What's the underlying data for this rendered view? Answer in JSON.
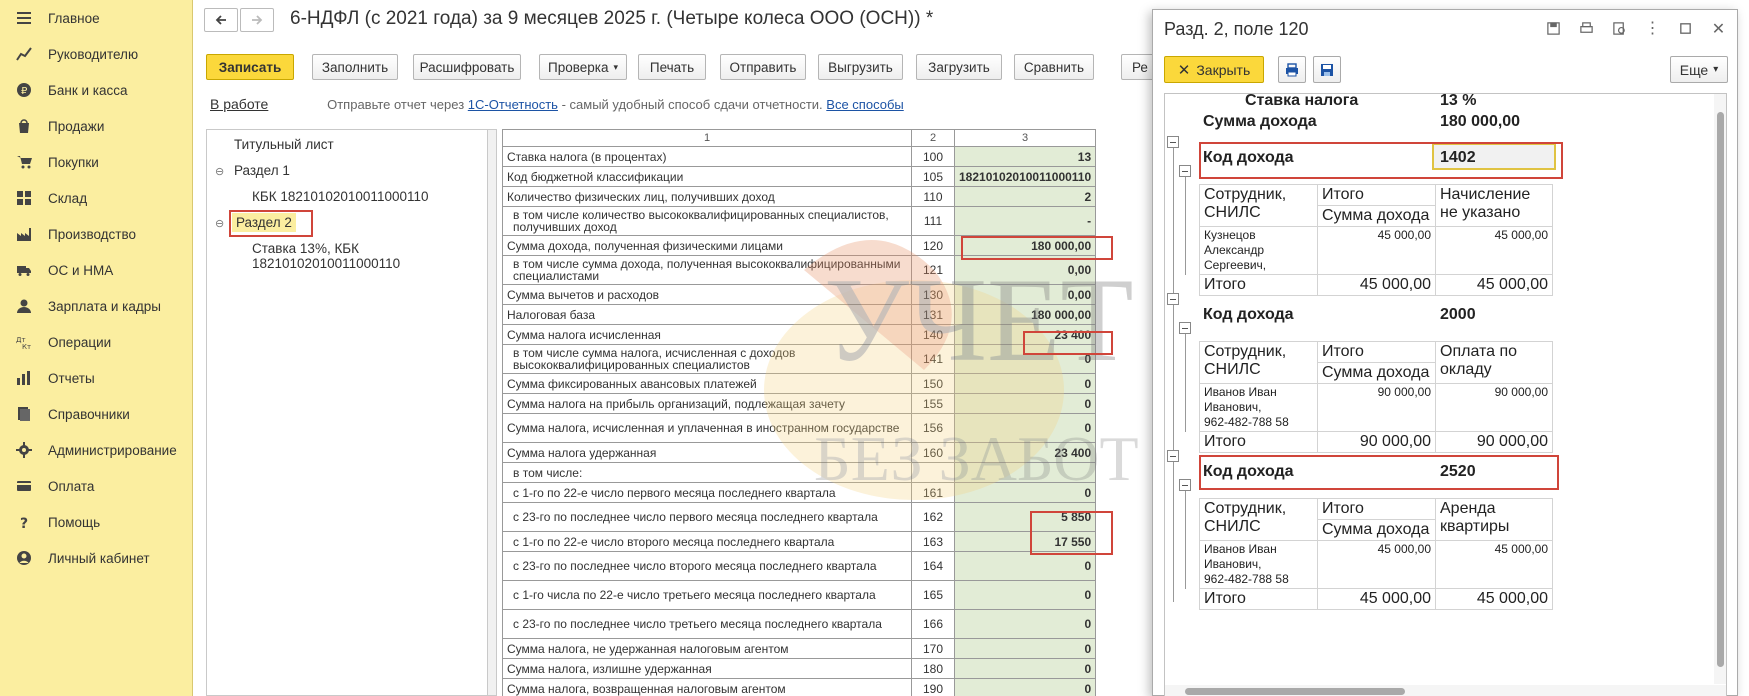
{
  "sidebar": {
    "items": [
      {
        "label": "Главное",
        "icon": "menu-icon"
      },
      {
        "label": "Руководителю",
        "icon": "chart-icon"
      },
      {
        "label": "Банк и касса",
        "icon": "ruble-icon"
      },
      {
        "label": "Продажи",
        "icon": "bag-icon"
      },
      {
        "label": "Покупки",
        "icon": "cart-icon"
      },
      {
        "label": "Склад",
        "icon": "grid-icon"
      },
      {
        "label": "Производство",
        "icon": "factory-icon"
      },
      {
        "label": "ОС и НМА",
        "icon": "truck-icon"
      },
      {
        "label": "Зарплата и кадры",
        "icon": "person-icon"
      },
      {
        "label": "Операции",
        "icon": "dtkt-icon"
      },
      {
        "label": "Отчеты",
        "icon": "bar-chart-icon"
      },
      {
        "label": "Справочники",
        "icon": "book-icon"
      },
      {
        "label": "Администрирование",
        "icon": "gear-icon"
      },
      {
        "label": "Оплата",
        "icon": "card-icon"
      },
      {
        "label": "Помощь",
        "icon": "question-icon"
      },
      {
        "label": "Личный кабинет",
        "icon": "account-icon"
      }
    ]
  },
  "header": {
    "title": "6-НДФЛ (с 2021 года) за 9 месяцев 2025 г. (Четыре колеса ООО (ОСН)) *"
  },
  "toolbar": {
    "save": "Записать",
    "fill": "Заполнить",
    "decode": "Расшифровать",
    "check": "Проверка",
    "print": "Печать",
    "send": "Отправить",
    "upload": "Выгрузить",
    "download": "Загрузить",
    "compare": "Сравнить",
    "cut": "Ре"
  },
  "status": {
    "state": "В работе",
    "info_pre": "Отправьте отчет через ",
    "info_link": "1С-Отчетность",
    "info_post": " - самый удобный способ сдачи отчетности. ",
    "all_ways": "Все способы"
  },
  "tree": {
    "title": "Титульный лист",
    "section1": "Раздел 1",
    "kbk1": "КБК 18210102010011000110",
    "section2": "Раздел 2",
    "rate_line1": "Ставка 13%, КБК",
    "rate_line2": "18210102010011000110"
  },
  "table": {
    "head": [
      "1",
      "2",
      "3"
    ],
    "rows": [
      {
        "name": "Ставка налога (в процентах)",
        "code": "100",
        "value": "13"
      },
      {
        "name": "Код бюджетной классификации",
        "code": "105",
        "value": "18210102010011000110"
      },
      {
        "name": "Количество физических лиц, получивших доход",
        "code": "110",
        "value": "2"
      },
      {
        "name": "в том числе количество высококвалифицированных специалистов, получивших доход",
        "code": "111",
        "value": "-"
      },
      {
        "name": "Сумма дохода, полученная физическими лицами",
        "code": "120",
        "value": "180 000,00"
      },
      {
        "name": "в том числе сумма дохода, полученная высококвалифицированными специалистами",
        "code": "121",
        "value": "0,00"
      },
      {
        "name": "Сумма вычетов и расходов",
        "code": "130",
        "value": "0,00"
      },
      {
        "name": "Налоговая база",
        "code": "131",
        "value": "180 000,00"
      },
      {
        "name": "Сумма налога исчисленная",
        "code": "140",
        "value": "23 400"
      },
      {
        "name": "в том числе сумма налога, исчисленная с доходов высококвалифицированных специалистов",
        "code": "141",
        "value": "0"
      },
      {
        "name": "Сумма фиксированных авансовых платежей",
        "code": "150",
        "value": "0"
      },
      {
        "name": "Сумма налога на прибыль организаций, подлежащая зачету",
        "code": "155",
        "value": "0"
      },
      {
        "name": "Сумма налога, исчисленная и уплаченная в иностранном государстве",
        "code": "156",
        "value": "0"
      },
      {
        "name": "Сумма налога удержанная",
        "code": "160",
        "value": "23 400"
      },
      {
        "name": "в том числе:",
        "code": "",
        "value": ""
      },
      {
        "name": "с 1-го по 22-е число первого месяца последнего квартала",
        "code": "161",
        "value": "0"
      },
      {
        "name": "с 23-го по последнее число первого месяца последнего квартала",
        "code": "162",
        "value": "5 850"
      },
      {
        "name": "с 1-го по 22-е число второго месяца последнего квартала",
        "code": "163",
        "value": "17 550"
      },
      {
        "name": "с 23-го по последнее число второго месяца последнего квартала",
        "code": "164",
        "value": "0"
      },
      {
        "name": "с 1-го числа по 22-е число третьего месяца последнего квартала",
        "code": "165",
        "value": "0"
      },
      {
        "name": "с 23-го по последнее число третьего месяца последнего квартала",
        "code": "166",
        "value": "0"
      },
      {
        "name": "Сумма налога, не удержанная налоговым агентом",
        "code": "170",
        "value": "0"
      },
      {
        "name": "Сумма налога, излишне удержанная",
        "code": "180",
        "value": "0"
      },
      {
        "name": "Сумма налога, возвращенная налоговым агентом",
        "code": "190",
        "value": "0"
      },
      {
        "name": "в том числе:",
        "code": "",
        "value": ""
      }
    ]
  },
  "watermark": {
    "line1": "УЧЕТ",
    "line2": "БЕЗ ЗАБОТ"
  },
  "panel": {
    "title": "Разд. 2, поле 120",
    "close": "Закрыть",
    "more": "Еще",
    "rate_label": "Ставка налога",
    "rate_value": "13 %",
    "income_label": "Сумма дохода",
    "income_value": "180 000,00",
    "groups": [
      {
        "code_label": "Код дохода",
        "code": "1402",
        "col1": "Сотрудник, СНИЛС",
        "col2a": "Итого",
        "col2b": "Сумма дохода",
        "col3": "Начисление не указано",
        "employee": "Кузнецов Александр Сергеевич,",
        "employee_snils": "",
        "amount": "45 000,00",
        "amount2": "45 000,00",
        "total_label": "Итого",
        "total": "45 000,00",
        "total2": "45 000,00"
      },
      {
        "code_label": "Код дохода",
        "code": "2000",
        "col1": "Сотрудник, СНИЛС",
        "col2a": "Итого",
        "col2b": "Сумма дохода",
        "col3": "Оплата по окладу",
        "employee": "Иванов Иван Иванович,",
        "employee_snils": "962-482-788 58",
        "amount": "90 000,00",
        "amount2": "90 000,00",
        "total_label": "Итого",
        "total": "90 000,00",
        "total2": "90 000,00"
      },
      {
        "code_label": "Код дохода",
        "code": "2520",
        "col1": "Сотрудник, СНИЛС",
        "col2a": "Итого",
        "col2b": "Сумма дохода",
        "col3": "Аренда квартиры",
        "employee": "Иванов Иван Иванович,",
        "employee_snils": "962-482-788 58",
        "amount": "45 000,00",
        "amount2": "45 000,00",
        "total_label": "Итого",
        "total": "45 000,00",
        "total2": "45 000,00"
      }
    ]
  },
  "colors": {
    "sidebar_bg": "#fbeea0",
    "accent_yellow": "#fbd83b",
    "highlight_red": "#d0453a",
    "value_cell_bg": "#e2ecd6",
    "link": "#1c53a5"
  }
}
